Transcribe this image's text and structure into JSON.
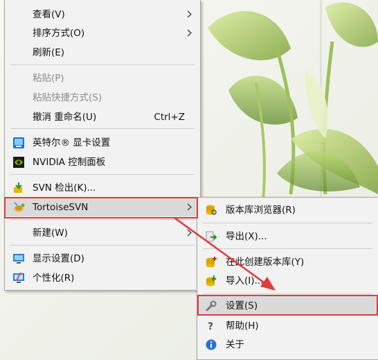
{
  "context_menu": {
    "items": [
      {
        "label": "查看(V)"
      },
      {
        "label": "排序方式(O)"
      },
      {
        "label": "刷新(E)"
      },
      {
        "label": "粘贴(P)"
      },
      {
        "label": "粘贴快捷方式(S)"
      },
      {
        "label": "撤消 重命名(U)",
        "shortcut": "Ctrl+Z"
      },
      {
        "label": "英特尔® 显卡设置"
      },
      {
        "label": "NVIDIA 控制面板"
      },
      {
        "label": "SVN 检出(K)..."
      },
      {
        "label": "TortoiseSVN"
      },
      {
        "label": "新建(W)"
      },
      {
        "label": "显示设置(D)"
      },
      {
        "label": "个性化(R)"
      }
    ]
  },
  "submenu": {
    "items": [
      {
        "label": "版本库浏览器(R)"
      },
      {
        "label": "导出(X)..."
      },
      {
        "label": "在此创建版本库(Y)"
      },
      {
        "label": "导入(I)..."
      },
      {
        "label": "设置(S)"
      },
      {
        "label": "帮助(H)"
      },
      {
        "label": "关于"
      }
    ]
  },
  "colors": {
    "highlight_box": "#e03a3a",
    "annotation_arrow": "#e03a3a",
    "menu_bg": "#f2f2f2"
  }
}
